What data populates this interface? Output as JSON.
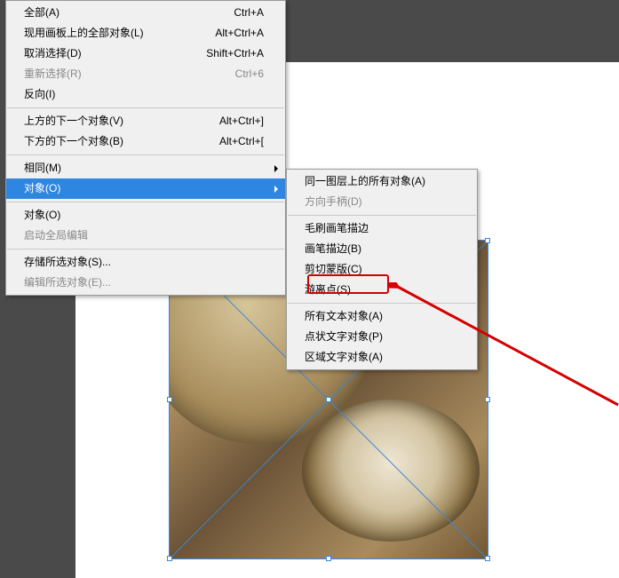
{
  "main_menu": {
    "items": [
      {
        "label": "全部(A)",
        "shortcut": "Ctrl+A",
        "enabled": true
      },
      {
        "label": "现用画板上的全部对象(L)",
        "shortcut": "Alt+Ctrl+A",
        "enabled": true
      },
      {
        "label": "取消选择(D)",
        "shortcut": "Shift+Ctrl+A",
        "enabled": true
      },
      {
        "label": "重新选择(R)",
        "shortcut": "Ctrl+6",
        "enabled": false
      },
      {
        "label": "反向(I)",
        "shortcut": "",
        "enabled": true
      }
    ],
    "items2": [
      {
        "label": "上方的下一个对象(V)",
        "shortcut": "Alt+Ctrl+]",
        "enabled": true
      },
      {
        "label": "下方的下一个对象(B)",
        "shortcut": "Alt+Ctrl+[",
        "enabled": true
      }
    ],
    "items3": [
      {
        "label": "相同(M)",
        "shortcut": "",
        "enabled": true,
        "submenu": true
      },
      {
        "label": "对象(O)",
        "shortcut": "",
        "enabled": true,
        "submenu": true,
        "highlighted": true
      }
    ],
    "items4": [
      {
        "label": "对象(O)",
        "shortcut": "",
        "enabled": true
      },
      {
        "label": "启动全局编辑",
        "shortcut": "",
        "enabled": false
      }
    ],
    "items5": [
      {
        "label": "存储所选对象(S)...",
        "shortcut": "",
        "enabled": true
      },
      {
        "label": "编辑所选对象(E)...",
        "shortcut": "",
        "enabled": false
      }
    ]
  },
  "sub_menu": {
    "items": [
      {
        "label": "同一图层上的所有对象(A)",
        "enabled": true
      },
      {
        "label": "方向手柄(D)",
        "enabled": false
      }
    ],
    "items2": [
      {
        "label": "毛刷画笔描边",
        "enabled": true
      },
      {
        "label": "画笔描边(B)",
        "enabled": true
      },
      {
        "label": "剪切蒙版(C)",
        "enabled": true
      },
      {
        "label": "游离点(S)",
        "enabled": true,
        "callout": true
      }
    ],
    "items3": [
      {
        "label": "所有文本对象(A)",
        "enabled": true
      },
      {
        "label": "点状文字对象(P)",
        "enabled": true
      },
      {
        "label": "区域文字对象(A)",
        "enabled": true
      }
    ]
  },
  "colors": {
    "highlight": "#2f86e0",
    "callout": "#d40000"
  }
}
